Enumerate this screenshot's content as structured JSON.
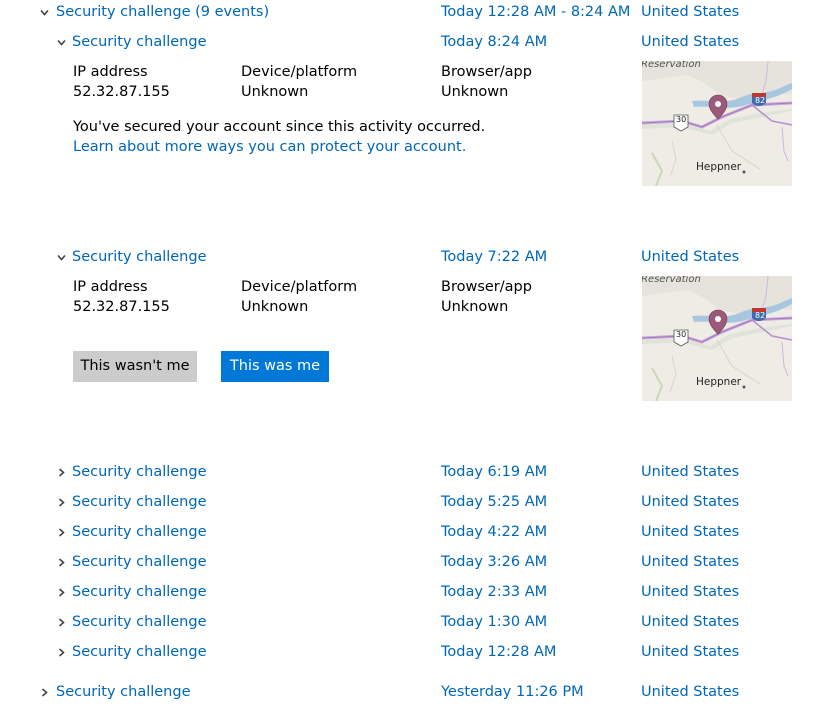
{
  "group": {
    "title": "Security challenge (9 events)",
    "time": "Today 12:28 AM - 8:24 AM",
    "location": "United States"
  },
  "detail_labels": {
    "ip": "IP address",
    "device": "Device/platform",
    "browser": "Browser/app"
  },
  "event1": {
    "title": "Security challenge",
    "time": "Today 8:24 AM",
    "location": "United States",
    "ip": "52.32.87.155",
    "device": "Unknown",
    "browser": "Unknown",
    "secured_note": "You've secured your account since this activity occurred.",
    "learn_link": "Learn about more ways you can protect your account."
  },
  "event2": {
    "title": "Security challenge",
    "time": "Today 7:22 AM",
    "location": "United States",
    "ip": "52.32.87.155",
    "device": "Unknown",
    "browser": "Unknown",
    "btn_not_me": "This wasn't me",
    "btn_me": "This was me"
  },
  "map": {
    "reservation_label": "Reservation",
    "city_label": "Heppner",
    "route_30": "30",
    "route_82": "82"
  },
  "collapsed_events": [
    {
      "title": "Security challenge",
      "time": "Today 6:19 AM",
      "location": "United States"
    },
    {
      "title": "Security challenge",
      "time": "Today 5:25 AM",
      "location": "United States"
    },
    {
      "title": "Security challenge",
      "time": "Today 4:22 AM",
      "location": "United States"
    },
    {
      "title": "Security challenge",
      "time": "Today 3:26 AM",
      "location": "United States"
    },
    {
      "title": "Security challenge",
      "time": "Today 2:33 AM",
      "location": "United States"
    },
    {
      "title": "Security challenge",
      "time": "Today 1:30 AM",
      "location": "United States"
    },
    {
      "title": "Security challenge",
      "time": "Today 12:28 AM",
      "location": "United States"
    }
  ],
  "last_event": {
    "title": "Security challenge",
    "time": "Yesterday 11:26 PM",
    "location": "United States"
  },
  "colors": {
    "link": "#0067b8",
    "primary_button": "#0078d7",
    "secondary_button": "#cccccc",
    "chevron": "#444444"
  },
  "icons": {
    "expanded": "chevron-down-icon",
    "collapsed": "chevron-right-icon",
    "map_pin": "map-pin-icon"
  }
}
